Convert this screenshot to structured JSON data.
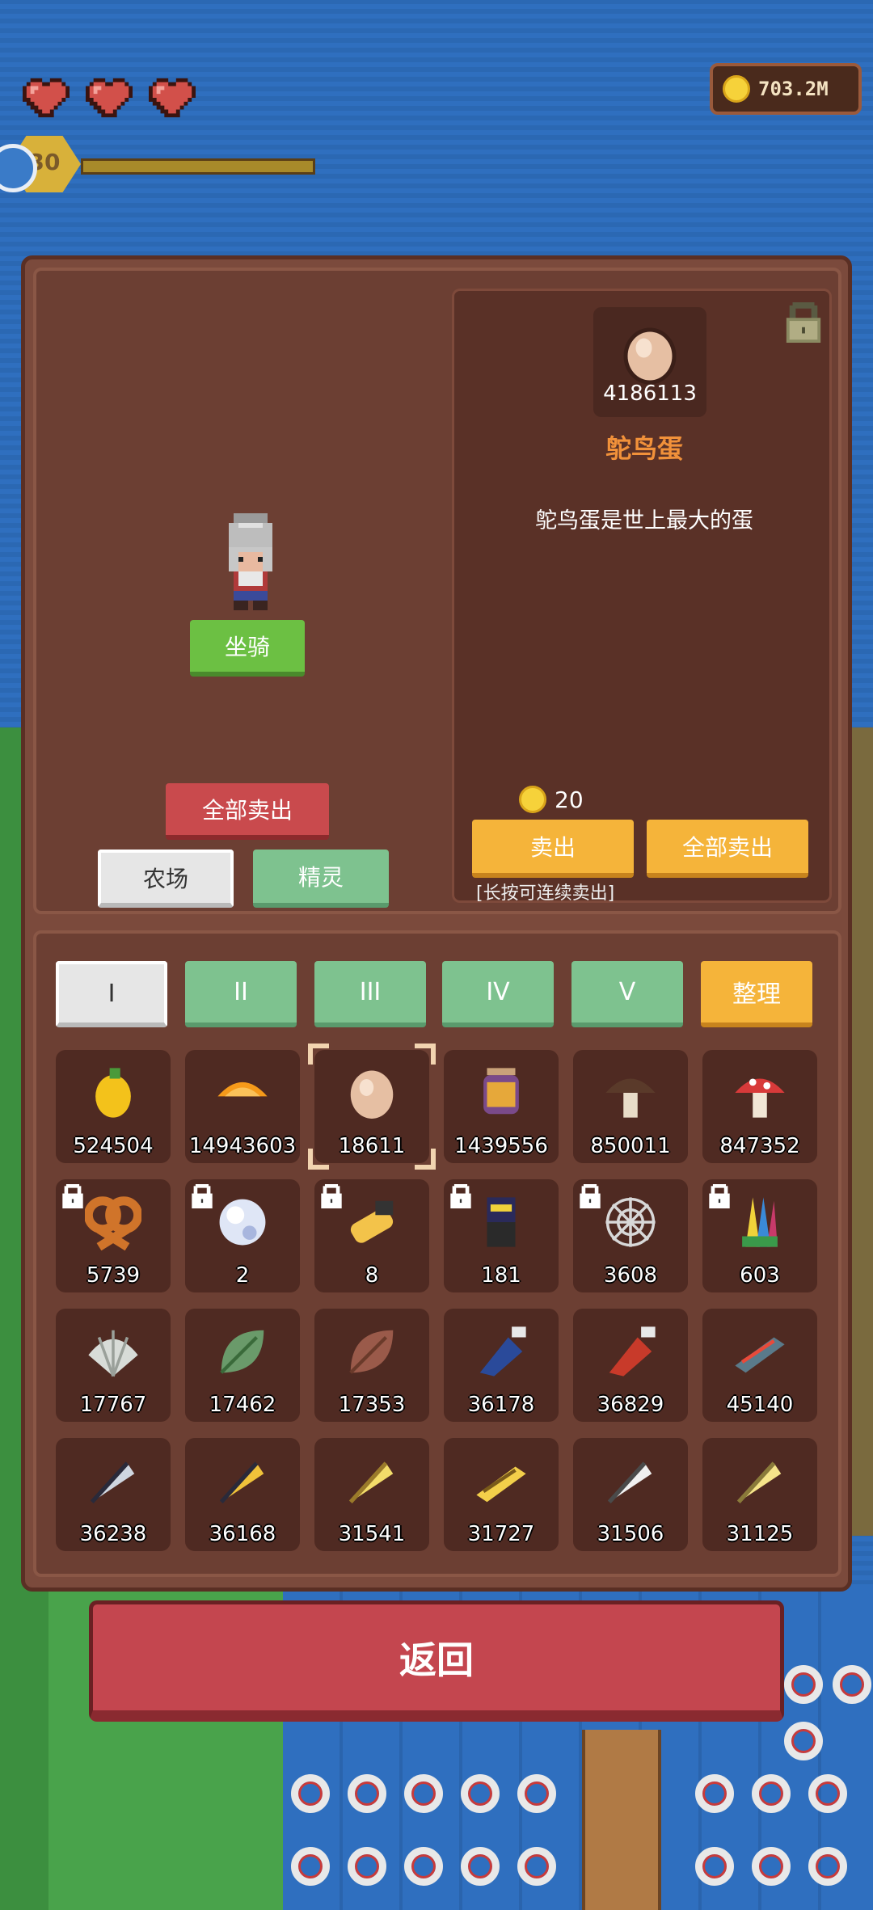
{
  "hud": {
    "hearts": 3,
    "coins": "703.2M",
    "level": "30"
  },
  "left": {
    "mount_button": "坐骑",
    "sell_all_button": "全部卖出",
    "tabs": [
      "农场",
      "精灵"
    ]
  },
  "detail": {
    "count": "4186113",
    "name": "鸵鸟蛋",
    "description": "鸵鸟蛋是世上最大的蛋",
    "price": "20",
    "sell_button": "卖出",
    "sell_all_button": "全部卖出",
    "hint": "[长按可连续卖出]"
  },
  "page_tabs": [
    "I",
    "II",
    "III",
    "IV",
    "V"
  ],
  "sort_button": "整理",
  "items": [
    {
      "icon": "mango-icon",
      "count": "524504",
      "locked": false
    },
    {
      "icon": "orange-slices-icon",
      "count": "14943603",
      "locked": false
    },
    {
      "icon": "ostrich-egg-icon",
      "count": "18611",
      "locked": false,
      "selected": true
    },
    {
      "icon": "honey-jar-icon",
      "count": "1439556",
      "locked": false
    },
    {
      "icon": "brown-mushroom-icon",
      "count": "850011",
      "locked": false
    },
    {
      "icon": "red-mushroom-icon",
      "count": "847352",
      "locked": false
    },
    {
      "icon": "pretzel-icon",
      "count": "5739",
      "locked": true
    },
    {
      "icon": "pearl-icon",
      "count": "2",
      "locked": true
    },
    {
      "icon": "scroll-icon",
      "count": "8",
      "locked": true
    },
    {
      "icon": "ninja-figure-icon",
      "count": "181",
      "locked": true
    },
    {
      "icon": "spider-web-icon",
      "count": "3608",
      "locked": true
    },
    {
      "icon": "feather-bundle-icon",
      "count": "603",
      "locked": true
    },
    {
      "icon": "shell-icon",
      "count": "17767",
      "locked": false
    },
    {
      "icon": "green-leaf-icon",
      "count": "17462",
      "locked": false
    },
    {
      "icon": "brown-leaf-icon",
      "count": "17353",
      "locked": false
    },
    {
      "icon": "blue-potion-icon",
      "count": "36178",
      "locked": false
    },
    {
      "icon": "red-potion-icon",
      "count": "36829",
      "locked": false
    },
    {
      "icon": "fish-icon",
      "count": "45140",
      "locked": false
    },
    {
      "icon": "silver-feather-icon",
      "count": "36238",
      "locked": false
    },
    {
      "icon": "gold-feather-icon",
      "count": "36168",
      "locked": false
    },
    {
      "icon": "yellow-feather-icon",
      "count": "31541",
      "locked": false
    },
    {
      "icon": "golden-fish-icon",
      "count": "31727",
      "locked": false
    },
    {
      "icon": "white-feather-icon",
      "count": "31506",
      "locked": false
    },
    {
      "icon": "light-feather-icon",
      "count": "31125",
      "locked": false
    }
  ],
  "back_button": "返回",
  "colors": {
    "panel": "#7b4a3c",
    "accent_orange": "#f1913a",
    "green": "#6cc043",
    "red": "#c94a4d"
  }
}
